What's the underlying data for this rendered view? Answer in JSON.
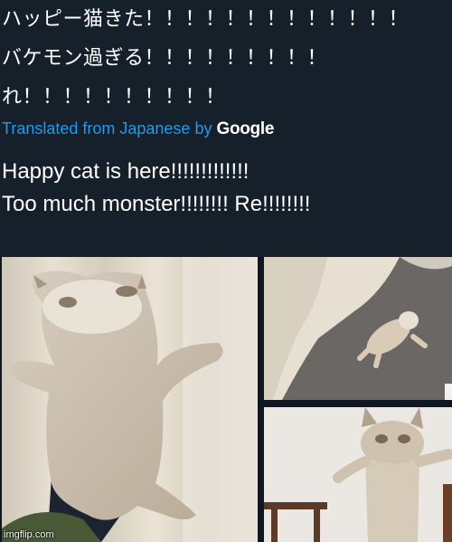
{
  "tweet": {
    "original_text": "ハッピー猫きた！！！！！！！！！！！！！\nバケモン過ぎる！！！！！！！！！\nれ！！！！！！！！！！",
    "translated_prefix": "Translated from Japanese by ",
    "translated_by": "Google",
    "translated_text": "Happy cat is here!!!!!!!!!!!!!\nToo much monster!!!!!!!! Re!!!!!!!!"
  },
  "media": {
    "images": [
      "cat-plush-held-photo",
      "cat-on-carpet-photo",
      "cat-standing-photo"
    ]
  },
  "watermark": "imgflip.com",
  "colors": {
    "background": "#15202b",
    "link": "#1d9bf0",
    "text": "#ffffff"
  }
}
